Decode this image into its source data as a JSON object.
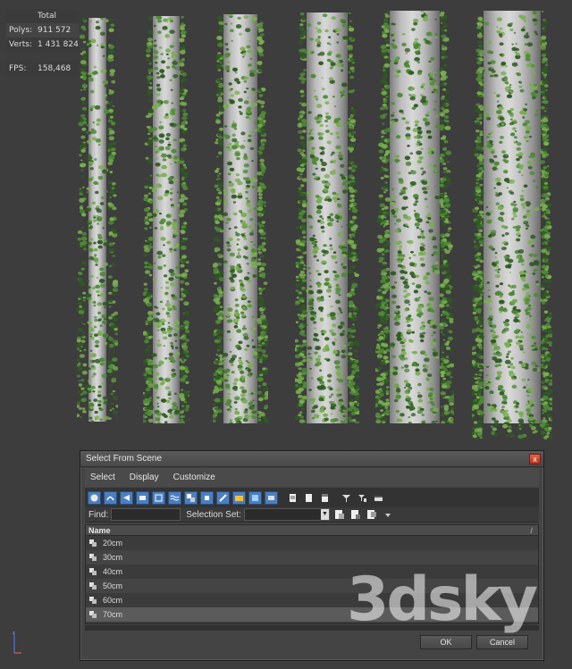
{
  "stats": {
    "header": "Total",
    "polys_label": "Polys:",
    "polys_value": "911 572",
    "verts_label": "Verts:",
    "verts_value": "1 431 824",
    "fps_label": "FPS:",
    "fps_value": "158,468"
  },
  "dialog": {
    "title": "Select From Scene",
    "close_glyph": "x",
    "menu": [
      "Select",
      "Display",
      "Customize"
    ],
    "find_label": "Find:",
    "find_value": "",
    "selection_set_label": "Selection Set:",
    "selection_set_value": "",
    "column_header": "Name",
    "sort_glyph": "/",
    "rows": [
      "20cm",
      "30cm",
      "40cm",
      "50cm",
      "60cm",
      "70cm"
    ],
    "selected_row": "70cm",
    "ok_label": "OK",
    "cancel_label": "Cancel"
  },
  "watermark": "3dsky",
  "colors": {
    "background": "#3d3d3d",
    "stats_text": "#e8d23a",
    "ivy_dark": "#2f5a22",
    "ivy_mid": "#4e8a35",
    "ivy_light": "#79ad4f",
    "toolbar_accent": "#4a7fc0",
    "close_button": "#c8432c"
  }
}
